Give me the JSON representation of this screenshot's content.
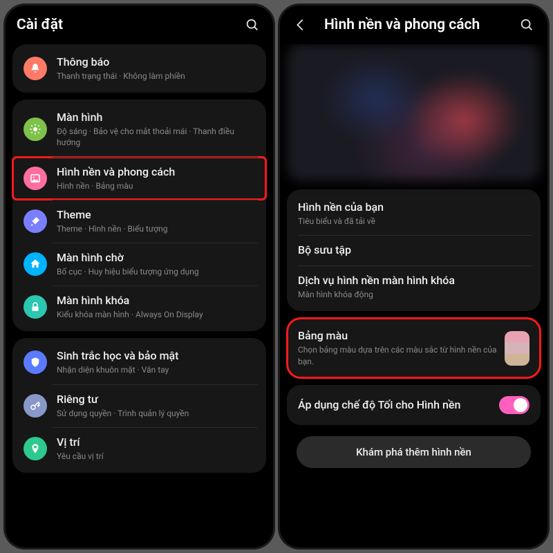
{
  "left": {
    "header": {
      "title": "Cài đặt"
    },
    "groups": [
      {
        "items": [
          {
            "icon": "bell-icon",
            "color": "#ff7a67",
            "title": "Thông báo",
            "sub": "Thanh trạng thái  ·  Không làm phiền"
          }
        ]
      },
      {
        "items": [
          {
            "icon": "brightness-icon",
            "color": "#7fc24b",
            "title": "Màn hình",
            "sub": "Độ sáng  ·  Bảo vệ cho mắt thoải mái  ·  Thanh điều hướng"
          },
          {
            "icon": "picture-icon",
            "color": "#ff6ea0",
            "title": "Hình nền và phong cách",
            "sub": "Hình nền  ·  Bảng màu",
            "highlight": true
          },
          {
            "icon": "brush-icon",
            "color": "#7a7fff",
            "title": "Theme",
            "sub": "Theme  ·  Hình nền  ·  Biểu tượng"
          },
          {
            "icon": "home-icon",
            "color": "#00b3ff",
            "title": "Màn hình chờ",
            "sub": "Bố cục  ·  Huy hiệu biểu tượng ứng dụng"
          },
          {
            "icon": "lock-icon",
            "color": "#2bc7b0",
            "title": "Màn hình khóa",
            "sub": "Kiểu khóa màn hình  ·  Always On Display"
          }
        ]
      },
      {
        "items": [
          {
            "icon": "shield-icon",
            "color": "#5b7bff",
            "title": "Sinh trắc học và bảo mật",
            "sub": "Nhận diện khuôn mặt  ·  Vân tay"
          },
          {
            "icon": "key-icon",
            "color": "#8898c8",
            "title": "Riêng tư",
            "sub": "Sử dụng quyền  ·  Trình quản lý quyền"
          },
          {
            "icon": "pin-icon",
            "color": "#2dc98f",
            "title": "Vị trí",
            "sub": "Yêu cầu vị trí"
          }
        ]
      }
    ]
  },
  "right": {
    "header": {
      "title": "Hình nền và phong cách"
    },
    "group1": [
      {
        "title": "Hình nền của bạn",
        "sub": "Tiêu biểu và đã tải về"
      },
      {
        "title": "Bộ sưu tập",
        "sub": ""
      },
      {
        "title": "Dịch vụ hình nền màn hình khóa",
        "sub": "Màn hình khóa động"
      }
    ],
    "palette_card": {
      "title": "Bảng màu",
      "sub": "Chọn bảng màu dựa trên các màu sắc từ hình nền của bạn.",
      "swatches": [
        "#e9a2b2",
        "#d6b3b8",
        "#cfb497"
      ]
    },
    "toggle_card": {
      "title": "Áp dụng chế độ Tối cho Hình nền"
    },
    "explore_btn": "Khám phá thêm hình nền"
  }
}
